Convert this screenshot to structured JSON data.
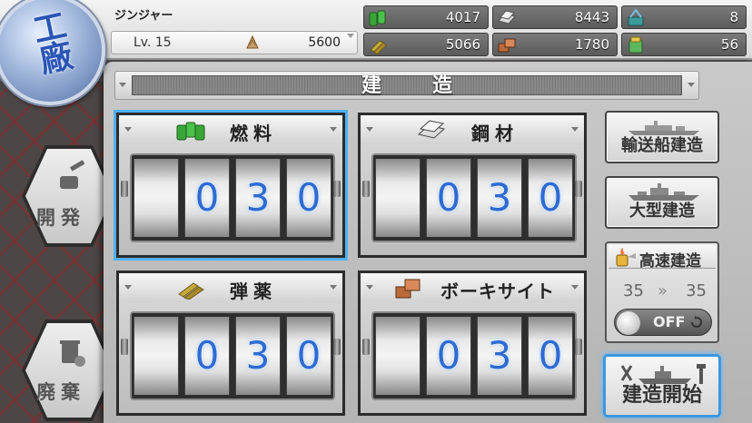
{
  "player": {
    "name": "ジンジャー",
    "level_label": "Lv. 15",
    "coins": "5600"
  },
  "resources": {
    "fuel": "4017",
    "steel": "8443",
    "dev_material": "8",
    "ammo": "5066",
    "bauxite": "1780",
    "instant_build": "56"
  },
  "emblem": {
    "text": "工廠"
  },
  "menu": {
    "develop": "開発",
    "scrap": "廃棄"
  },
  "panel": {
    "title": "建造",
    "inputs": [
      {
        "label": "燃料",
        "digits": [
          "0",
          "3",
          "0"
        ]
      },
      {
        "label": "鋼材",
        "digits": [
          "0",
          "3",
          "0"
        ]
      },
      {
        "label": "弾薬",
        "digits": [
          "0",
          "3",
          "0"
        ]
      },
      {
        "label": "ボーキサイト",
        "digits": [
          "0",
          "3",
          "0"
        ]
      }
    ]
  },
  "side": {
    "transport_build": "輸送船建造",
    "large_build": "大型建造",
    "fast_build": "高速建造",
    "fast_from": "35",
    "fast_arrow": "»",
    "fast_to": "35",
    "toggle": "OFF",
    "start_build": "建造開始"
  },
  "colors": {
    "accent_blue": "#4fb0ef",
    "digit_blue": "#2e6bd1"
  }
}
